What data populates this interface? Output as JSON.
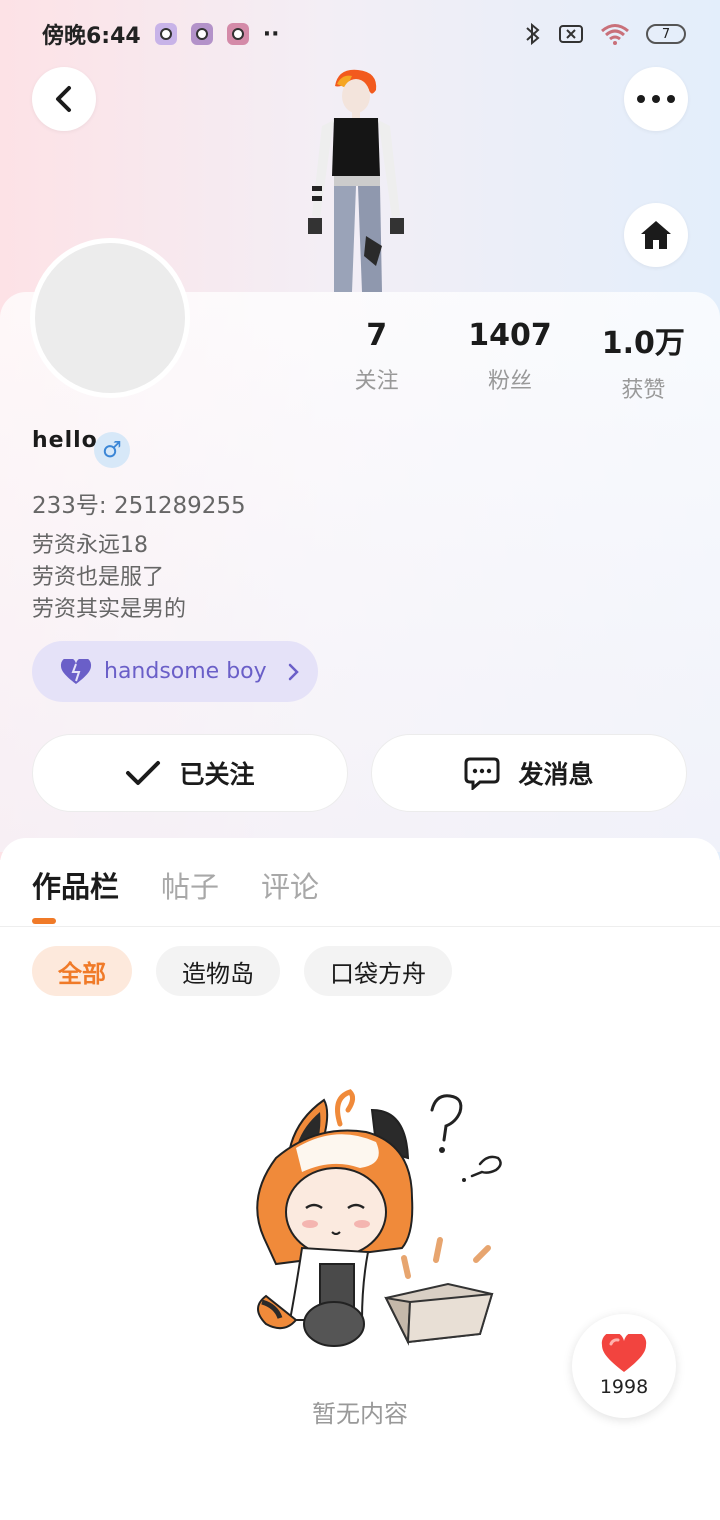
{
  "status_bar": {
    "time": "傍晚6:44",
    "battery": "7",
    "more_dots": "··"
  },
  "icons": {
    "back": "chevron-left-icon",
    "more": "more-dots-icon",
    "home": "home-icon",
    "gender": "male-icon",
    "tag": "heart-icon",
    "follow": "check-icon",
    "message": "chat-bubble-icon",
    "like": "heart-icon"
  },
  "colors": {
    "accent": "#f07a28",
    "tag_purple": "#6a5fc8",
    "gender_blue": "#3b86d6",
    "like_red": "#f2443f"
  },
  "profile": {
    "username": "hello",
    "gender_symbol": "♂",
    "uid": "233号: 251289255",
    "bio": [
      "劳资永远18",
      "劳资也是服了",
      "劳资其实是男的"
    ],
    "tag": "handsome boy"
  },
  "stats": [
    {
      "value": "7",
      "label": "关注"
    },
    {
      "value": "1407",
      "label": "粉丝"
    },
    {
      "value": "1.0万",
      "label": "获赞"
    }
  ],
  "actions": {
    "follow_label": "已关注",
    "message_label": "发消息"
  },
  "tabs": [
    {
      "label": "作品栏",
      "active": true
    },
    {
      "label": "帖子",
      "active": false
    },
    {
      "label": "评论",
      "active": false
    }
  ],
  "filters": [
    {
      "label": "全部",
      "active": true
    },
    {
      "label": "造物岛",
      "active": false
    },
    {
      "label": "口袋方舟",
      "active": false
    }
  ],
  "empty_state": {
    "text": "暂无内容"
  },
  "like_button": {
    "count": "1998"
  }
}
